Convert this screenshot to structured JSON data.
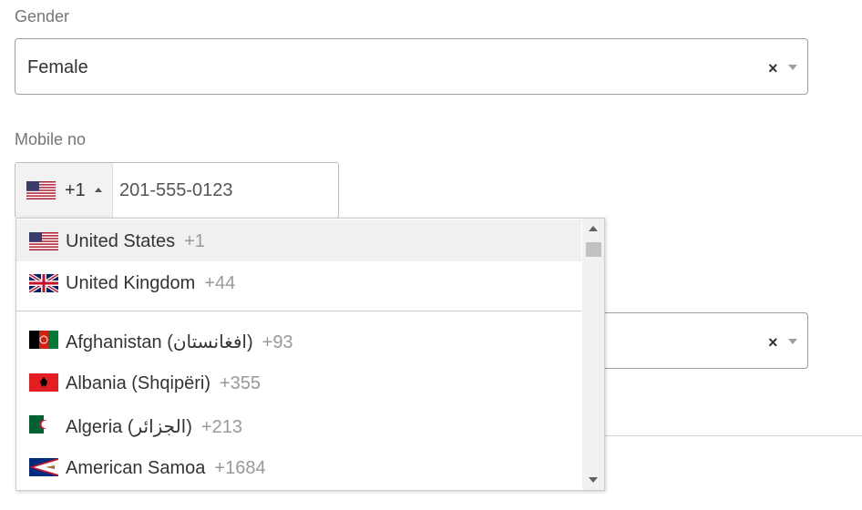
{
  "gender": {
    "label": "Gender",
    "value": "Female",
    "clear_glyph": "×"
  },
  "mobile": {
    "label": "Mobile no",
    "dial_code": "+1",
    "value": "201-555-0123",
    "selected_flag": "us-flag"
  },
  "hidden_select": {
    "clear_glyph": "×"
  },
  "country_dropdown": {
    "preferred": [
      {
        "name": "United States",
        "code": "+1",
        "flag": "us-flag",
        "highlighted": true
      },
      {
        "name": "United Kingdom",
        "code": "+44",
        "flag": "uk-flag",
        "highlighted": false
      }
    ],
    "countries": [
      {
        "name": "Afghanistan (افغانستان)",
        "code": "+93",
        "flag": "af-flag"
      },
      {
        "name": "Albania (Shqipëri)",
        "code": "+355",
        "flag": "al-flag"
      },
      {
        "name": "Algeria (الجزائر)",
        "code": "+213",
        "flag": "dz-flag"
      },
      {
        "name": "American Samoa",
        "code": "+1684",
        "flag": "as-flag"
      }
    ]
  },
  "colors": {
    "border": "#9e9e9e",
    "highlight": "#f0f0f0",
    "muted_text": "#999999"
  }
}
